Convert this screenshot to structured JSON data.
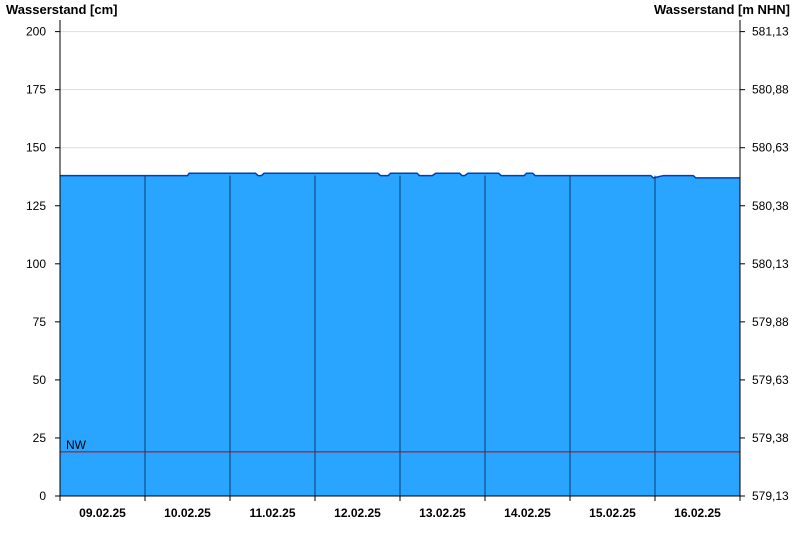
{
  "chart_data": {
    "type": "area",
    "y_left_label": "Wasserstand [cm]",
    "y_right_label": "Wasserstand [m NHN]",
    "y_left": {
      "range": [
        0,
        205
      ],
      "ticks": [
        "0",
        "25",
        "50",
        "75",
        "100",
        "125",
        "150",
        "175",
        "200"
      ]
    },
    "y_right": {
      "ticks": [
        "579,13",
        "579,38",
        "579,63",
        "579,88",
        "580,13",
        "580,38",
        "580,63",
        "580,88",
        "581,13"
      ]
    },
    "x": {
      "range": [
        0,
        8
      ],
      "tick_labels": [
        "09.02.25",
        "10.02.25",
        "11.02.25",
        "12.02.25",
        "13.02.25",
        "14.02.25",
        "15.02.25",
        "16.02.25"
      ]
    },
    "grid": true,
    "series": [
      {
        "x": [
          0.0,
          0.5,
          1.0,
          1.5,
          1.52,
          2.0,
          2.3,
          2.33,
          2.37,
          2.4,
          2.7,
          3.0,
          3.5,
          3.74,
          3.77,
          3.86,
          3.89,
          4.2,
          4.23,
          4.38,
          4.42,
          4.6,
          4.7,
          4.73,
          4.76,
          4.8,
          5.0,
          5.16,
          5.19,
          5.4,
          5.46,
          5.49,
          5.56,
          5.59,
          5.8,
          6.0,
          6.5,
          6.95,
          6.98,
          7.1,
          7.45,
          7.48,
          8.0
        ],
        "y": [
          138,
          138,
          138,
          138,
          139,
          139,
          139,
          138,
          138,
          139,
          139,
          139,
          139,
          139,
          138,
          138,
          139,
          139,
          138,
          138,
          139,
          139,
          139,
          138,
          138,
          139,
          139,
          139,
          138,
          138,
          138,
          139,
          139,
          138,
          138,
          138,
          138,
          138,
          137,
          138,
          138,
          137,
          137
        ],
        "color": "#29A5FF",
        "line_color": "#003FAE"
      }
    ],
    "reference_lines": [
      {
        "label": "NW",
        "value": 19,
        "color": "#C00000"
      }
    ]
  }
}
